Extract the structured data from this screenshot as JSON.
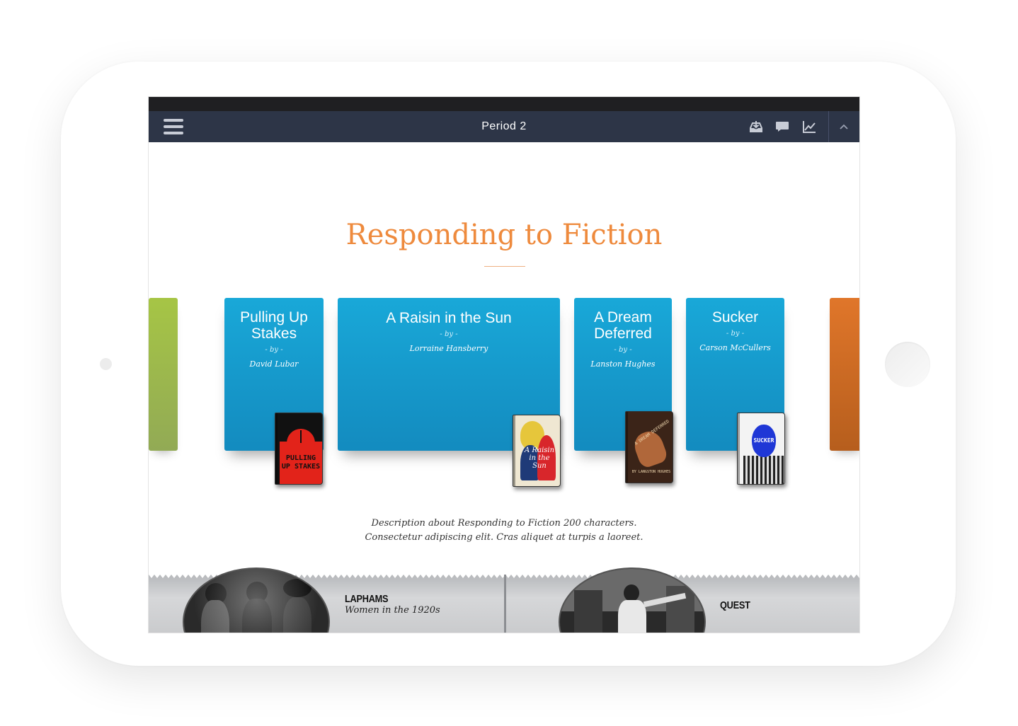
{
  "nav": {
    "title": "Period 2",
    "icons": [
      "menu-icon",
      "inbox-download-icon",
      "chat-bubble-icon",
      "line-chart-icon",
      "chevron-up-icon"
    ]
  },
  "section": {
    "title": "Responding to Fiction",
    "description_line1": "Description about Responding to Fiction 200 characters.",
    "description_line2": "Consectetur adipiscing elit. Cras aliquet at turpis a laoreet."
  },
  "cards": [
    {
      "title": "Pulling Up Stakes",
      "by": "- by -",
      "author": "David Lubar",
      "cover_label": "PULLING UP STAKES"
    },
    {
      "title": "A Raisin in the Sun",
      "by": "- by -",
      "author": "Lorraine Hansberry",
      "cover_label": "A Raisin in the Sun"
    },
    {
      "title": "A Dream Deferred",
      "by": "- by -",
      "author": "Lanston Hughes",
      "cover_label": "A DREAM DEFERRED",
      "cover_sublabel": "BY LANGSTON HUGHES"
    },
    {
      "title": "Sucker",
      "by": "- by -",
      "author": "Carson McCullers",
      "cover_label": "SUCKER"
    }
  ],
  "strip": {
    "left": {
      "title": "LAPHAMS",
      "subtitle": "Women in the 1920s"
    },
    "right": {
      "title": "QUEST"
    }
  },
  "colors": {
    "nav_bg": "#2d3547",
    "accent_orange": "#ee8a3d",
    "card_blue": "#19a8d8",
    "edge_green": "#a6c545",
    "edge_orange": "#e0762a"
  }
}
